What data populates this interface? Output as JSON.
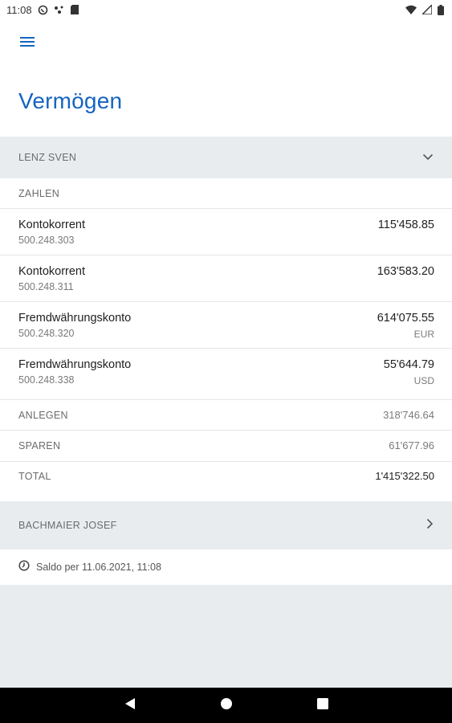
{
  "status_bar": {
    "time": "11:08",
    "left_icons": [
      "whatsapp-icon",
      "network-signal-icon",
      "sd-card-icon"
    ],
    "right_icons": [
      "wifi-icon",
      "cell-signal-icon",
      "battery-icon"
    ]
  },
  "header": {
    "menu_icon": "hamburger-menu-icon",
    "title": "Vermögen"
  },
  "owners": [
    {
      "name": "LENZ SVEN",
      "expanded": true,
      "chevron": "chevron-down-icon",
      "group_label": "ZAHLEN",
      "accounts": [
        {
          "name": "Kontokorrent",
          "number": "500.248.303",
          "amount": "115'458.85",
          "currency": ""
        },
        {
          "name": "Kontokorrent",
          "number": "500.248.311",
          "amount": "163'583.20",
          "currency": ""
        },
        {
          "name": "Fremdwährungskonto",
          "number": "500.248.320",
          "amount": "614'075.55",
          "currency": "EUR"
        },
        {
          "name": "Fremdwährungskonto",
          "number": "500.248.338",
          "amount": "55'644.79",
          "currency": "USD"
        }
      ],
      "summary": [
        {
          "label": "ANLEGEN",
          "value": "318'746.64"
        },
        {
          "label": "SPAREN",
          "value": "61'677.96"
        },
        {
          "label": "TOTAL",
          "value": "1'415'322.50"
        }
      ]
    },
    {
      "name": "BACHMAIER JOSEF",
      "expanded": false,
      "chevron": "chevron-right-icon"
    }
  ],
  "footer": {
    "icon": "clock-icon",
    "saldo_text": "Saldo per 11.06.2021, 11:08"
  },
  "nav_bar": [
    "back-icon",
    "home-icon",
    "recents-icon"
  ],
  "colors": {
    "accent": "#1565c0",
    "section_bg": "#e9ecef",
    "nav_bar": "#000000"
  }
}
